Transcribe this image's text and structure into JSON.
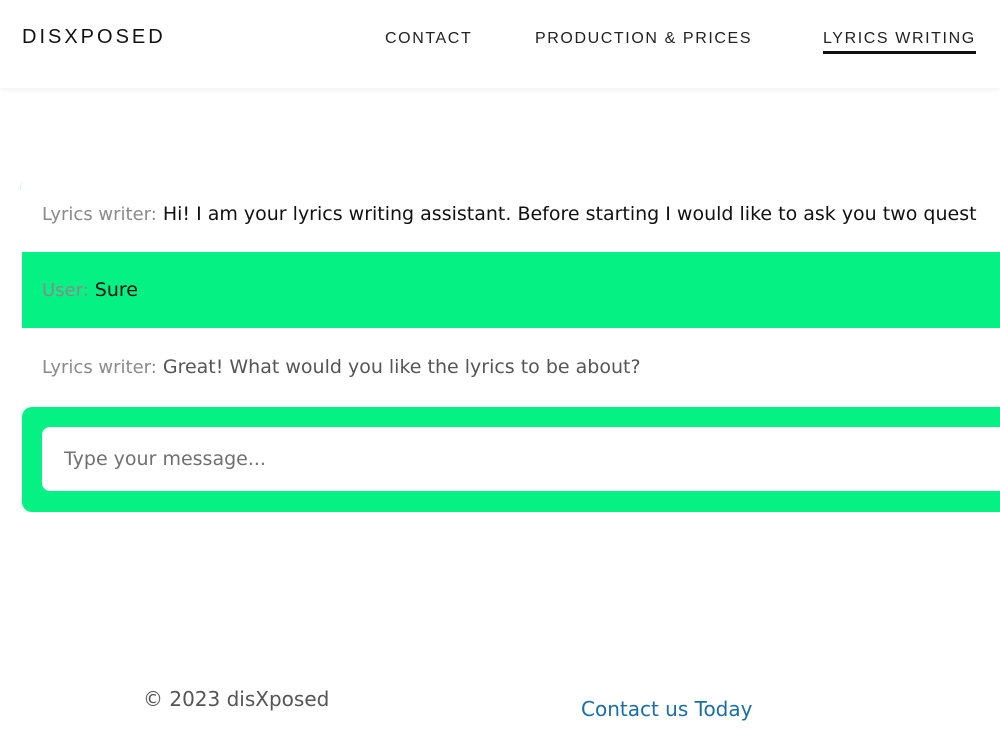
{
  "header": {
    "brand": "DISXPOSED",
    "nav": {
      "contact": "CONTACT",
      "production": "PRODUCTION & PRICES",
      "lyrics": "LYRICS WRITING"
    }
  },
  "chat": {
    "messages": [
      {
        "speaker": "Lyrics writer:",
        "text": "Hi! I am your lyrics writing assistant. Before starting I would like to ask you two quest"
      },
      {
        "speaker": "User:",
        "text": "Sure"
      },
      {
        "speaker": "Lyrics writer:",
        "text": "Great! What would you like the lyrics to be about?"
      }
    ],
    "input": {
      "placeholder": "Type your message...",
      "value": ""
    }
  },
  "footer": {
    "copyright": "© 2023 disXposed",
    "contact_link": "Contact us Today"
  },
  "colors": {
    "accent_green": "#06f184",
    "link_blue": "#1a6ea3"
  }
}
